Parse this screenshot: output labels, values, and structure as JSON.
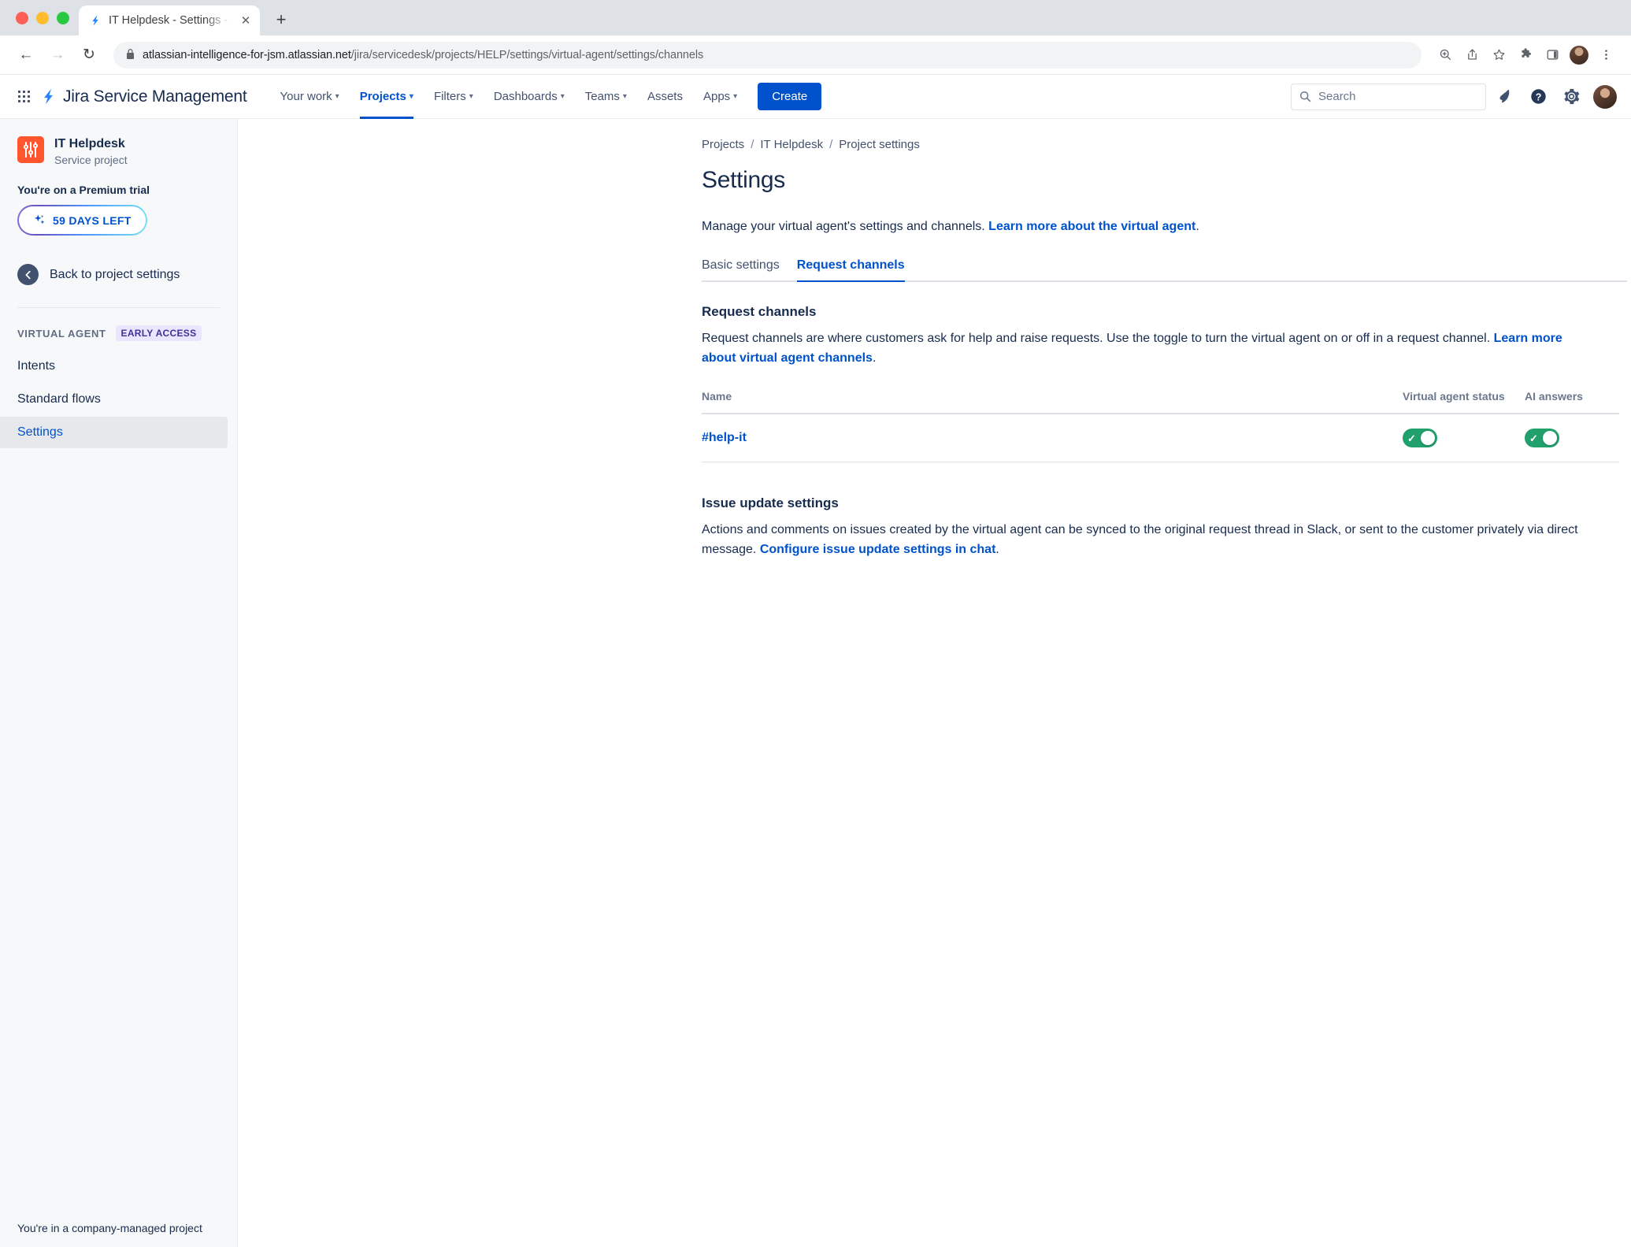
{
  "browser": {
    "tab": {
      "title": "IT Helpdesk - Settings - Servic",
      "favicon": "jira-bolt-icon",
      "close_label": "✕"
    },
    "new_tab_label": "+",
    "nav": {
      "back": "←",
      "forward": "→",
      "reload": "↻"
    },
    "omnibox": {
      "lock_icon": "lock-icon",
      "host": "atlassian-intelligence-for-jsm.atlassian.net",
      "path": "/jira/servicedesk/projects/HELP/settings/virtual-agent/settings/channels",
      "full_url": "atlassian-intelligence-for-jsm.atlassian.net/jira/servicedesk/projects/HELP/settings/virtual-agent/settings/channels"
    },
    "toolbar_icons": [
      "zoom-icon",
      "share-icon",
      "bookmark-star-icon",
      "extensions-puzzle-icon",
      "side-panel-icon",
      "profile-avatar",
      "kebab-menu-icon"
    ]
  },
  "topnav": {
    "app_switcher_icon": "app-switcher-grid-icon",
    "logo_icon": "jira-bolt-icon",
    "product_name": "Jira Service Management",
    "items": [
      {
        "label": "Your work",
        "has_caret": true,
        "active": false
      },
      {
        "label": "Projects",
        "has_caret": true,
        "active": true
      },
      {
        "label": "Filters",
        "has_caret": true,
        "active": false
      },
      {
        "label": "Dashboards",
        "has_caret": true,
        "active": false
      },
      {
        "label": "Teams",
        "has_caret": true,
        "active": false
      },
      {
        "label": "Assets",
        "has_caret": false,
        "active": false
      },
      {
        "label": "Apps",
        "has_caret": true,
        "active": false
      }
    ],
    "create_label": "Create",
    "search_placeholder": "Search",
    "right_icons": [
      "notifications-bell-icon",
      "help-question-icon",
      "settings-gear-icon",
      "user-avatar"
    ]
  },
  "sidebar": {
    "project": {
      "name": "IT Helpdesk",
      "type": "Service project",
      "icon": "service-project-icon",
      "icon_color": "#ff5630"
    },
    "trial": {
      "label": "You're on a Premium trial",
      "badge": "59 DAYS LEFT",
      "badge_icon": "sparkle-icon"
    },
    "back": {
      "label": "Back to project settings",
      "icon": "back-arrow-icon"
    },
    "section": {
      "label": "VIRTUAL AGENT",
      "badge": "EARLY ACCESS"
    },
    "items": [
      {
        "label": "Intents",
        "active": false
      },
      {
        "label": "Standard flows",
        "active": false
      },
      {
        "label": "Settings",
        "active": true
      }
    ],
    "footer": "You're in a company-managed project"
  },
  "main": {
    "breadcrumb": [
      "Projects",
      "IT Helpdesk",
      "Project settings"
    ],
    "breadcrumb_separator": "/",
    "page_title": "Settings",
    "intro_text": "Manage your virtual agent's settings and channels. ",
    "intro_link": "Learn more about the virtual agent",
    "intro_period": ".",
    "tabs": [
      {
        "label": "Basic settings",
        "active": false
      },
      {
        "label": "Request channels",
        "active": true
      }
    ],
    "request_channels": {
      "title": "Request channels",
      "body_text": "Request channels are where customers ask for help and raise requests. Use the toggle to turn the virtual agent on or off in a request channel. ",
      "body_link": "Learn more about virtual agent channels",
      "body_period": ".",
      "columns": {
        "name": "Name",
        "status": "Virtual agent status",
        "ai": "AI answers"
      },
      "rows": [
        {
          "name": "#help-it",
          "virtual_agent_status": true,
          "ai_answers": true
        }
      ]
    },
    "issue_update": {
      "title": "Issue update settings",
      "body_text": "Actions and comments on issues created by the virtual agent can be synced to the original request thread in Slack, or sent to the customer privately via direct message. ",
      "body_link": "Configure issue update settings in chat",
      "body_period": "."
    }
  },
  "colors": {
    "accent_blue": "#0052cc",
    "toggle_green": "#22a06b",
    "project_orange": "#ff5630",
    "early_access_bg": "#eae6ff",
    "early_access_text": "#403294",
    "text_primary": "#172b4d",
    "text_subtle": "#6b778c"
  }
}
